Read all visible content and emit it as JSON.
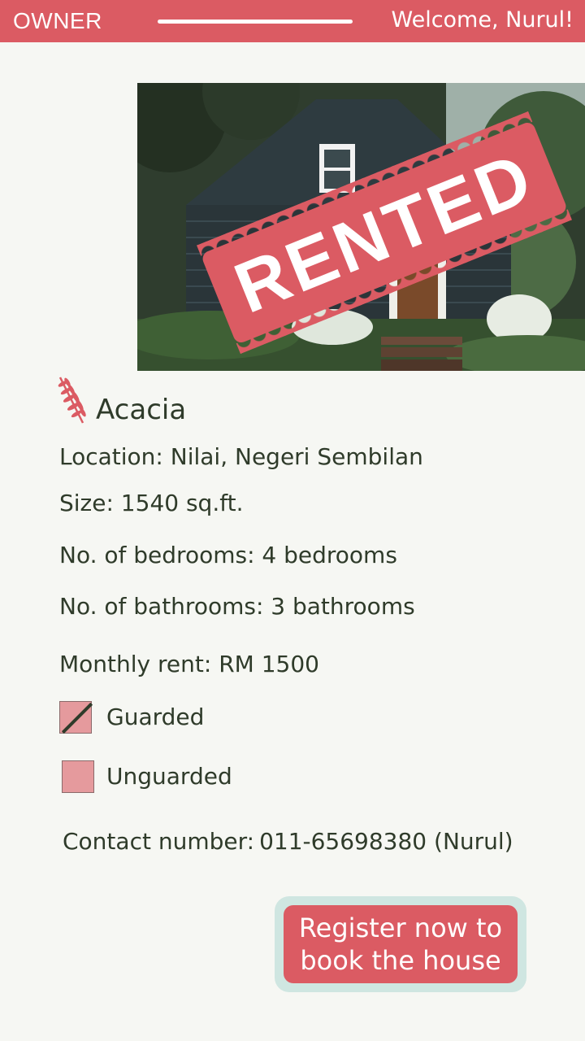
{
  "header": {
    "role_label": "OWNER",
    "welcome": "Welcome, Nurul!"
  },
  "listing": {
    "status_stamp": "RENTED",
    "name": "Acacia",
    "location": "Location: Nilai, Negeri Sembilan",
    "size": "Size: 1540 sq.ft.",
    "bedrooms": "No. of bedrooms: 4 bedrooms",
    "bathrooms": "No. of bathrooms: 3 bathrooms",
    "rent": "Monthly rent: RM 1500",
    "security_options": [
      {
        "label": "Guarded",
        "checked": true
      },
      {
        "label": "Unguarded",
        "checked": false
      }
    ],
    "contact_label": "Contact number:",
    "contact_value": "011-65698380 (Nurul)"
  },
  "cta": {
    "line1": "Register now to",
    "line2": "book the house"
  },
  "colors": {
    "accent": "#db5b63",
    "text": "#2f3b2a",
    "background": "#f6f7f3",
    "button_outline": "#cfe6e1"
  }
}
